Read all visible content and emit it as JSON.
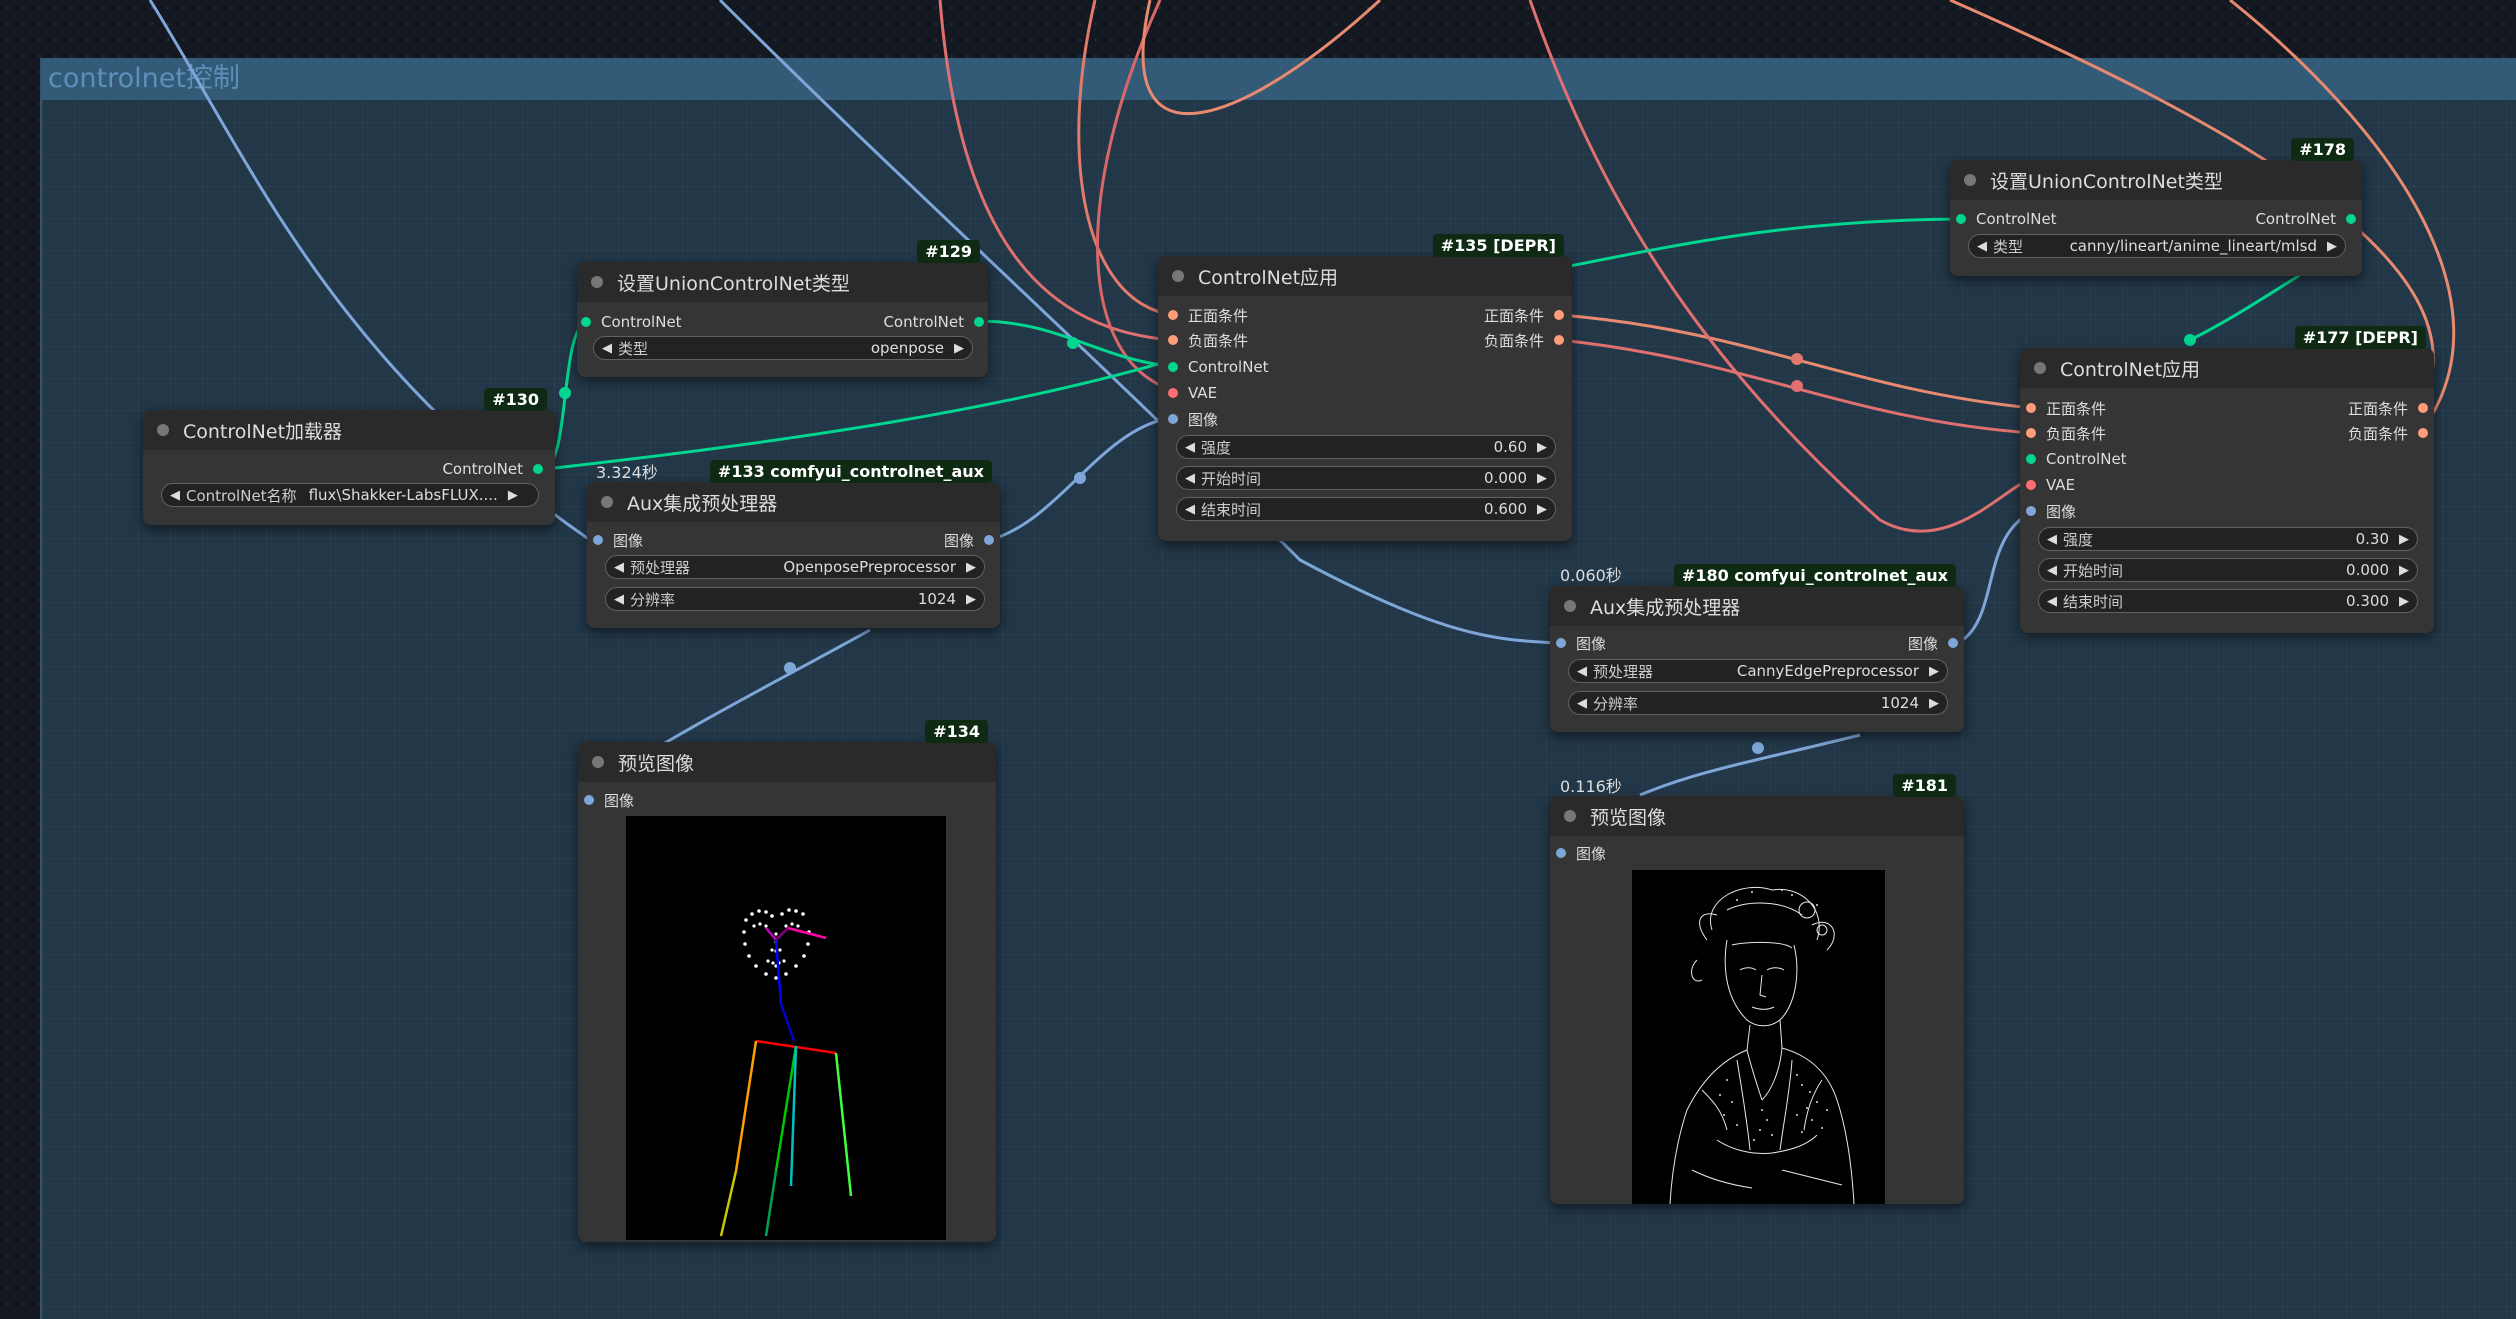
{
  "group": {
    "title": "controlnet控制"
  },
  "colors": {
    "controlnet_wire": "#00d68f",
    "conditioning_pos_wire": "#ff9d7a",
    "conditioning_neg_wire": "#e07070",
    "image_wire": "#7fa6d9",
    "badge_bg": "#0e2a12"
  },
  "nodes": {
    "loader": {
      "id": "#130",
      "title": "ControlNet加载器",
      "output": "ControlNet",
      "widget": {
        "label": "ControlNet名称",
        "value": "flux\\Shakker-LabsFLUX...."
      }
    },
    "union1": {
      "id": "#129",
      "title": "设置UnionControlNet类型",
      "input": "ControlNet",
      "output": "ControlNet",
      "widget": {
        "label": "类型",
        "value": "openpose"
      }
    },
    "aux1": {
      "id": "#133 comfyui_controlnet_aux",
      "timing": "3.324秒",
      "title": "Aux集成预处理器",
      "input": "图像",
      "output": "图像",
      "widgets": [
        {
          "label": "预处理器",
          "value": "OpenposePreprocessor"
        },
        {
          "label": "分辨率",
          "value": "1024"
        }
      ]
    },
    "preview1": {
      "id": "#134",
      "title": "预览图像",
      "input": "图像"
    },
    "apply1": {
      "id": "#135 [DEPR]",
      "title": "ControlNet应用",
      "inputs": [
        "正面条件",
        "负面条件",
        "ControlNet",
        "VAE",
        "图像"
      ],
      "outputs": [
        "正面条件",
        "负面条件"
      ],
      "widgets": [
        {
          "label": "强度",
          "value": "0.60"
        },
        {
          "label": "开始时间",
          "value": "0.000"
        },
        {
          "label": "结束时间",
          "value": "0.600"
        }
      ]
    },
    "union2": {
      "id": "#178",
      "title": "设置UnionControlNet类型",
      "input": "ControlNet",
      "output": "ControlNet",
      "widget": {
        "label": "类型",
        "value": "canny/lineart/anime_lineart/mlsd"
      }
    },
    "apply2": {
      "id": "#177 [DEPR]",
      "title": "ControlNet应用",
      "inputs": [
        "正面条件",
        "负面条件",
        "ControlNet",
        "VAE",
        "图像"
      ],
      "outputs": [
        "正面条件",
        "负面条件"
      ],
      "widgets": [
        {
          "label": "强度",
          "value": "0.30"
        },
        {
          "label": "开始时间",
          "value": "0.000"
        },
        {
          "label": "结束时间",
          "value": "0.300"
        }
      ]
    },
    "aux2": {
      "id": "#180 comfyui_controlnet_aux",
      "timing": "0.060秒",
      "title": "Aux集成预处理器",
      "input": "图像",
      "output": "图像",
      "widgets": [
        {
          "label": "预处理器",
          "value": "CannyEdgePreprocessor"
        },
        {
          "label": "分辨率",
          "value": "1024"
        }
      ]
    },
    "preview2": {
      "id": "#181",
      "timing": "0.116秒",
      "title": "预览图像",
      "input": "图像"
    }
  }
}
